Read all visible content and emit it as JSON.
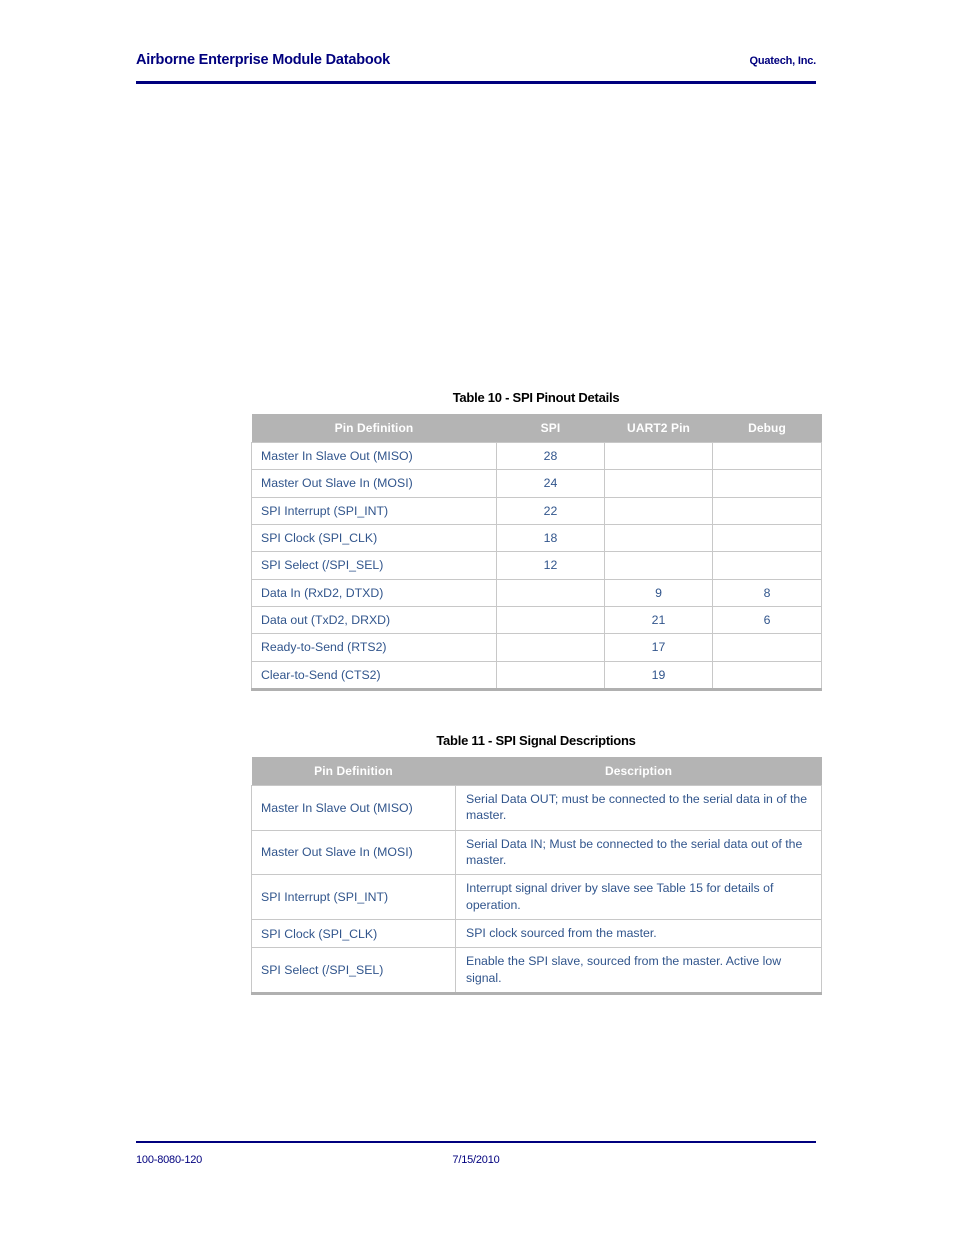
{
  "header": {
    "title": "Airborne Enterprise Module Databook",
    "company": "Quatech, Inc.",
    "rule_color": "#00007e"
  },
  "footer": {
    "doc_number": "100-8080-120",
    "date": "7/15/2010",
    "rule_color": "#00007e"
  },
  "colors": {
    "header_text": "#00007e",
    "table_header_bg": "#b4b4b4",
    "table_header_text": "#ffffff",
    "table_body_text": "#31558c",
    "table_border": "#c8c8c8",
    "caption_text": "#000000"
  },
  "table10": {
    "caption": "Table 10 - SPI Pinout Details",
    "columns": [
      "Pin Definition",
      "SPI",
      "UART2 Pin",
      "Debug"
    ],
    "rows": [
      {
        "pin": "Master In Slave Out (MISO)",
        "spi": "28",
        "uart2": "",
        "debug": ""
      },
      {
        "pin": "Master Out Slave In (MOSI)",
        "spi": "24",
        "uart2": "",
        "debug": ""
      },
      {
        "pin": "SPI Interrupt (SPI_INT)",
        "spi": "22",
        "uart2": "",
        "debug": ""
      },
      {
        "pin": "SPI Clock (SPI_CLK)",
        "spi": "18",
        "uart2": "",
        "debug": ""
      },
      {
        "pin": "SPI Select (/SPI_SEL)",
        "spi": "12",
        "uart2": "",
        "debug": ""
      },
      {
        "pin": "Data In (RxD2, DTXD)",
        "spi": "",
        "uart2": "9",
        "debug": "8"
      },
      {
        "pin": "Data out (TxD2, DRXD)",
        "spi": "",
        "uart2": "21",
        "debug": "6"
      },
      {
        "pin": "Ready-to-Send (RTS2)",
        "spi": "",
        "uart2": "17",
        "debug": ""
      },
      {
        "pin": "Clear-to-Send (CTS2)",
        "spi": "",
        "uart2": "19",
        "debug": ""
      }
    ]
  },
  "table11": {
    "caption": "Table 11 - SPI Signal Descriptions",
    "columns": [
      "Pin Definition",
      "Description"
    ],
    "rows": [
      {
        "pin": "Master In Slave Out (MISO)",
        "description": "Serial Data OUT; must be connected to the serial data in of the master."
      },
      {
        "pin": "Master Out Slave In (MOSI)",
        "description": "Serial Data IN; Must be connected to the serial data out of the master."
      },
      {
        "pin": "SPI Interrupt (SPI_INT)",
        "description": "Interrupt signal driver by slave see Table 15 for details of operation."
      },
      {
        "pin": "SPI Clock (SPI_CLK)",
        "description": "SPI clock sourced from the master."
      },
      {
        "pin": "SPI Select (/SPI_SEL)",
        "description": "Enable the SPI slave, sourced from the master. Active low signal."
      }
    ]
  }
}
